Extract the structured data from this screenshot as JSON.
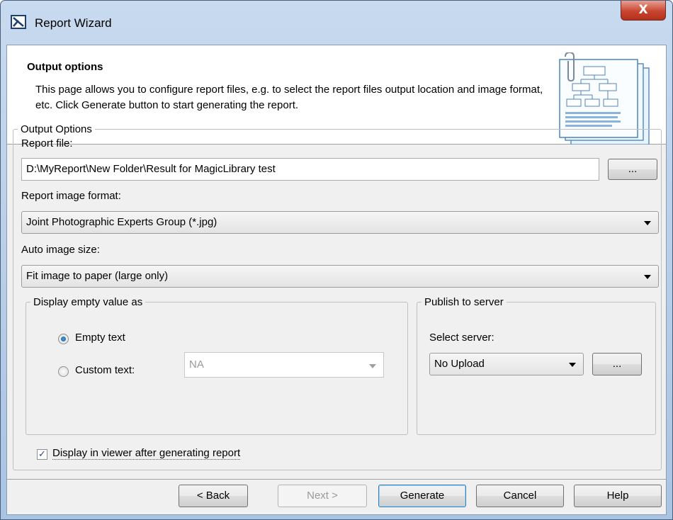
{
  "window": {
    "title": "Report Wizard",
    "close_label": "X"
  },
  "header": {
    "title": "Output options",
    "description": "This page allows you to configure report files, e.g. to select the report files output location and image format, etc. Click Generate button to start generating the report."
  },
  "output_options": {
    "legend": "Output Options",
    "report_file_label": "Report file:",
    "report_file_value": "D:\\MyReport\\New Folder\\Result for MagicLibrary test",
    "browse_label": "...",
    "image_format_label": "Report image format:",
    "image_format_value": "Joint Photographic Experts Group (*.jpg)",
    "auto_size_label": "Auto image size:",
    "auto_size_value": "Fit image to paper (large only)"
  },
  "empty_value": {
    "legend": "Display empty value as",
    "empty_text_label": "Empty text",
    "empty_text_selected": true,
    "custom_text_label": "Custom text:",
    "custom_text_value": "NA"
  },
  "publish": {
    "legend": "Publish to server",
    "select_server_label": "Select server:",
    "server_value": "No Upload",
    "browse_label": "..."
  },
  "viewer_checkbox": {
    "label": "Display in viewer after generating report",
    "checked": true
  },
  "buttons": {
    "back": "< Back",
    "next": "Next >",
    "generate": "Generate",
    "cancel": "Cancel",
    "help": "Help"
  },
  "icons": {
    "app": "report-wizard-icon",
    "close": "close-icon",
    "document": "report-document-icon",
    "dropdown": "chevron-down-icon"
  },
  "colors": {
    "close_button": "#c8452f",
    "title_bar": "#c7daef",
    "radio_dot": "#1c5a96"
  }
}
